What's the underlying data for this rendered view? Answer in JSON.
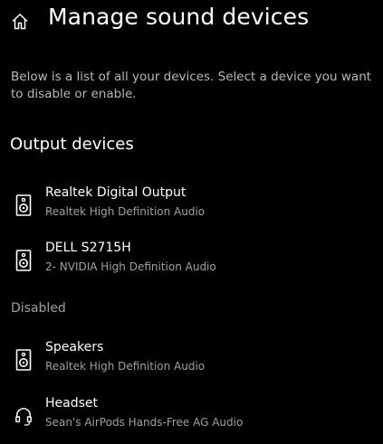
{
  "header": {
    "title": "Manage sound devices",
    "home_icon": "home-icon"
  },
  "description": "Below is a list of all your devices. Select a device you want to disable or enable.",
  "output_section": {
    "heading": "Output devices",
    "devices": [
      {
        "name": "Realtek Digital Output",
        "driver": "Realtek High Definition Audio",
        "icon": "speaker-icon"
      },
      {
        "name": "DELL S2715H",
        "driver": "2- NVIDIA High Definition Audio",
        "icon": "speaker-icon"
      }
    ]
  },
  "disabled_section": {
    "label": "Disabled",
    "devices": [
      {
        "name": "Speakers",
        "driver": "Realtek High Definition Audio",
        "icon": "speaker-icon"
      },
      {
        "name": "Headset",
        "driver": "Sean's AirPods Hands-Free AG Audio",
        "icon": "headset-icon"
      }
    ]
  },
  "colors": {
    "background": "#000000",
    "text": "#ffffff",
    "secondary_text": "#a0a0a0"
  }
}
